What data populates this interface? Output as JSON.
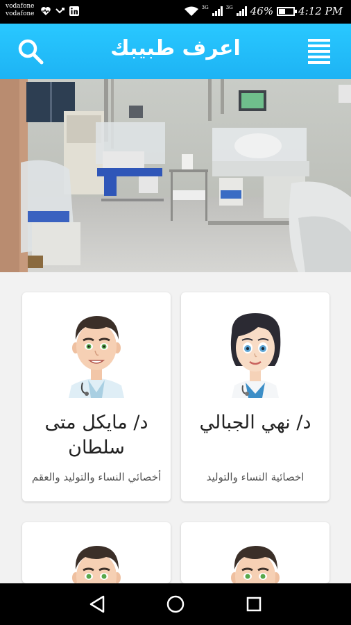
{
  "status_bar": {
    "carrier_1": "vodafone",
    "carrier_2": "vodafone",
    "network_1": "3G",
    "network_2": "3G",
    "battery_percent": "46%",
    "time": "4:12 PM",
    "battery_level": 0.46
  },
  "app_bar": {
    "title": "اعرف طبيبك",
    "search_icon": "search-icon",
    "menu_icon": "menu-icon"
  },
  "hero": {
    "image": "hospital-neonatal-room-photo"
  },
  "doctors": [
    {
      "name": "د/ نهي الجبالي",
      "specialty": "اخصائية النساء والتوليد",
      "avatar": "female-doctor-avatar"
    },
    {
      "name": "د/ مايكل متى سلطان",
      "specialty": "أخصائي النساء والتوليد والعقم",
      "avatar": "male-doctor-avatar"
    },
    {
      "name": "",
      "specialty": "",
      "avatar": "male-doctor-avatar"
    },
    {
      "name": "",
      "specialty": "",
      "avatar": "male-doctor-avatar"
    }
  ],
  "nav_bar": {
    "back": "back-icon",
    "home": "home-icon",
    "recents": "recents-icon"
  },
  "colors": {
    "app_bar": "#1db3f4",
    "background": "#f2f2f2",
    "card": "#ffffff"
  }
}
